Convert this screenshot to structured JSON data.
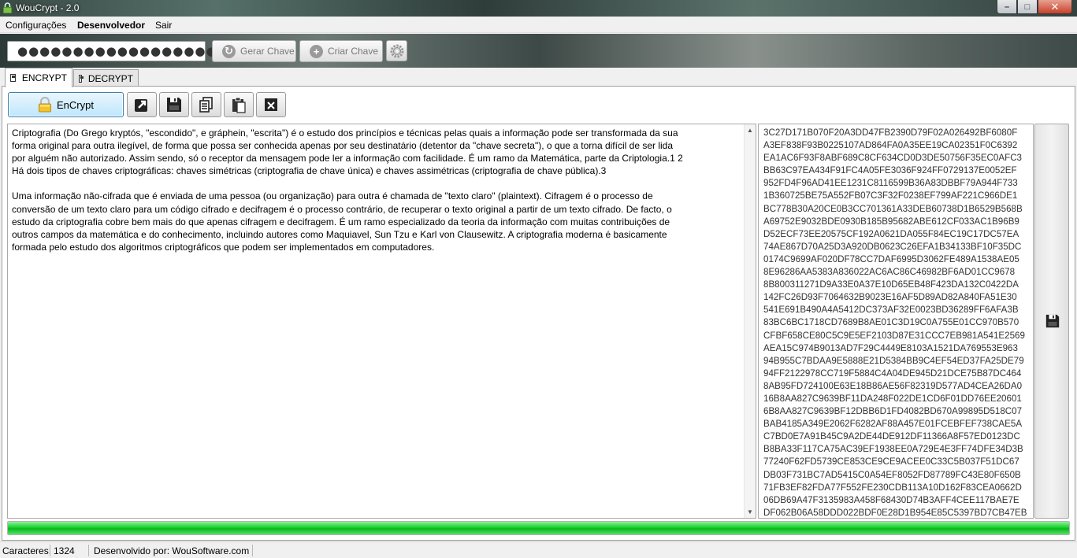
{
  "window": {
    "title": "WouCrypt - 2.0",
    "minimize": "–",
    "maximize": "□",
    "close": "✕"
  },
  "menu": {
    "items": [
      "Configurações",
      "Desenvolvedor",
      "Sair"
    ]
  },
  "toolbar": {
    "password_mask": "●●●●●●●●●●●●●●●●●●●●●●●",
    "gerar_chave": "Gerar Chave",
    "criar_chave": "Criar Chave"
  },
  "tabs": [
    {
      "label": "ENCRYPT",
      "active": true
    },
    {
      "label": "DECRYPT",
      "active": false
    }
  ],
  "actions": {
    "encrypt_label": "EnCrypt"
  },
  "plaintext": "Criptografia (Do Grego kryptós, \"escondido\", e gráphein, \"escrita\") é o estudo dos princípios e técnicas pelas quais a informação pode ser transformada da sua\nforma original para outra ilegível, de forma que possa ser conhecida apenas por seu destinatário (detentor da \"chave secreta\"), o que a torna difícil de ser lida\npor alguém não autorizado. Assim sendo, só o receptor da mensagem pode ler a informação com facilidade. É um ramo da Matemática, parte da Criptologia.1 2\nHá dois tipos de chaves criptográficas: chaves simétricas (criptografia de chave única) e chaves assimétricas (criptografia de chave pública).3\n\nUma informação não-cifrada que é enviada de uma pessoa (ou organização) para outra é chamada de \"texto claro\" (plaintext). Cifragem é o processo de\nconversão de um texto claro para um código cifrado e decifragem é o processo contrário, de recuperar o texto original a partir de um texto cifrado. De facto, o\nestudo da criptografia cobre bem mais do que apenas cifragem e decifragem. É um ramo especializado da teoria da informação com muitas contribuições de\noutros campos da matemática e do conhecimento, incluindo autores como Maquiavel, Sun Tzu e Karl von Clausewitz. A criptografia moderna é basicamente\nformada pelo estudo dos algoritmos criptográficos que podem ser implementados em computadores.",
  "ciphertext": "3C27D171B070F20A3DD47FB2390D79F02A026492BF6080F\nA3EF838F93B0225107AD864FA0A35EE19CA02351F0C6392\nEA1AC6F93F8ABF689C8CF634CD0D3DE50756F35EC0AFC3\nBB63C97EA434F91FC4A05FE3036F924FF0729137E0052EF\n952FD4F96AD41EE1231C8116599B36A83DBBF79A944F733\n1B360725BE75A552FB07C3F32F0238EF799AF221C966DE1\nBC778B30A20CE0B3CC701361A33DEB60738D1B6529B568B\nA69752E9032BDE0930B185B95682ABE612CF033AC1B96B9\nD52ECF73EE20575CF192A0621DA055F84EC19C17DC57EA\n74AE867D70A25D3A920DB0623C26EFA1B34133BF10F35DC\n0174C9699AF020DF78CC7DAF6995D3062FE489A1538AE05\n8E96286AA5383A836022AC6AC86C46982BF6AD01CC9678\n8B800311271D9A33E0A37E10D65EB48F423DA132C0422DA\n142FC26D93F7064632B9023E16AF5D89AD82A840FA51E30\n541E691B490A4A5412DC373AF32E0023BD36289FF6AFA3B\n83BC6BC1718CD7689B8AE01C3D19C0A755E01CC970B570\nCFBF658CE80C5C9E5EF2103D87E31CCC7EB981A541E2569\nAEA15C974B9013AD7F29C4449E8103A1521DA769553E963\n94B955C7BDAA9E5888E21D5384BB9C4EF54ED37FA25DE79\n94FF2122978CC719F5884C4A04DE945D21DCE75B87DC464\n8AB95FD724100E63E18B86AE56F82319D577AD4CEA26DA0\n16B8AA827C9639BF11DA248F022DE1CD6F01DD76EE20601\n6B8AA827C9639BF12DBB6D1FD4082BD670A99895D518C07\nBAB4185A349E2062F6282AF88A457E01FCEBFEF738CAE5A\nC7BD0E7A91B45C9A2DE44DE912DF11366A8F57ED0123DC\nB8BA33F117CA75AC39EF1938EE0A729E4E3FF74DFE34D3B\n77240F62FD5739CE853CE9CE9ACEE0C33C5B037F51DC67\nDB03F731BC7AD5415C0A54EF8052FD87789FC43E80F650B\n71FB3EF82FDA77F552FE230CDB113A10D162F83CEA0662D\n06DB69A47F3135983A458F68430D74B3AFF4CEE117BAE7E\nDF062B06A58DDD022BDF0E28D1B954E85C5397BD7CB47EB",
  "progress": {
    "value": 1.0,
    "color": "#17d12c"
  },
  "status": {
    "chars_label": "Caracteres:",
    "chars_count": "1324",
    "developer": "Desenvolvido por: WouSoftware.com"
  }
}
